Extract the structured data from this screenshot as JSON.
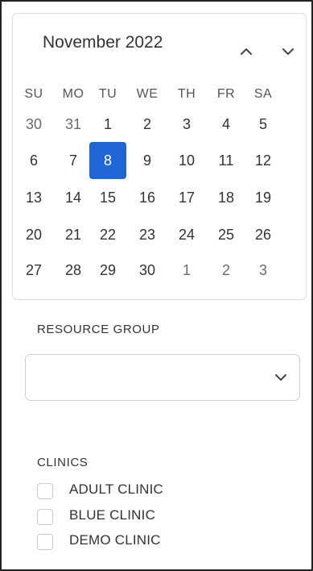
{
  "calendar": {
    "month_label": "November 2022",
    "prev_icon": "chevron-up-icon",
    "next_icon": "chevron-down-icon",
    "weekdays": [
      "SU",
      "MO",
      "TU",
      "WE",
      "TH",
      "FR",
      "SA"
    ],
    "weeks": [
      [
        {
          "d": "30",
          "m": true
        },
        {
          "d": "31",
          "m": true
        },
        {
          "d": "1"
        },
        {
          "d": "2"
        },
        {
          "d": "3"
        },
        {
          "d": "4"
        },
        {
          "d": "5"
        }
      ],
      [
        {
          "d": "6"
        },
        {
          "d": "7"
        },
        {
          "d": "8",
          "sel": true
        },
        {
          "d": "9"
        },
        {
          "d": "10"
        },
        {
          "d": "11"
        },
        {
          "d": "12"
        }
      ],
      [
        {
          "d": "13"
        },
        {
          "d": "14"
        },
        {
          "d": "15"
        },
        {
          "d": "16"
        },
        {
          "d": "17"
        },
        {
          "d": "18"
        },
        {
          "d": "19"
        }
      ],
      [
        {
          "d": "20"
        },
        {
          "d": "21"
        },
        {
          "d": "22"
        },
        {
          "d": "23"
        },
        {
          "d": "24"
        },
        {
          "d": "25"
        },
        {
          "d": "26"
        }
      ],
      [
        {
          "d": "27"
        },
        {
          "d": "28"
        },
        {
          "d": "29"
        },
        {
          "d": "30"
        },
        {
          "d": "1",
          "m": true
        },
        {
          "d": "2",
          "m": true
        },
        {
          "d": "3",
          "m": true
        }
      ]
    ],
    "selected_color": "#1f65d6"
  },
  "resource_group": {
    "label": "RESOURCE GROUP",
    "value": "",
    "dropdown_icon": "chevron-down-icon"
  },
  "clinics": {
    "label": "CLINICS",
    "items": [
      {
        "label": "ADULT CLINIC",
        "checked": false
      },
      {
        "label": "BLUE CLINIC",
        "checked": false
      },
      {
        "label": "DEMO CLINIC",
        "checked": false
      }
    ]
  }
}
